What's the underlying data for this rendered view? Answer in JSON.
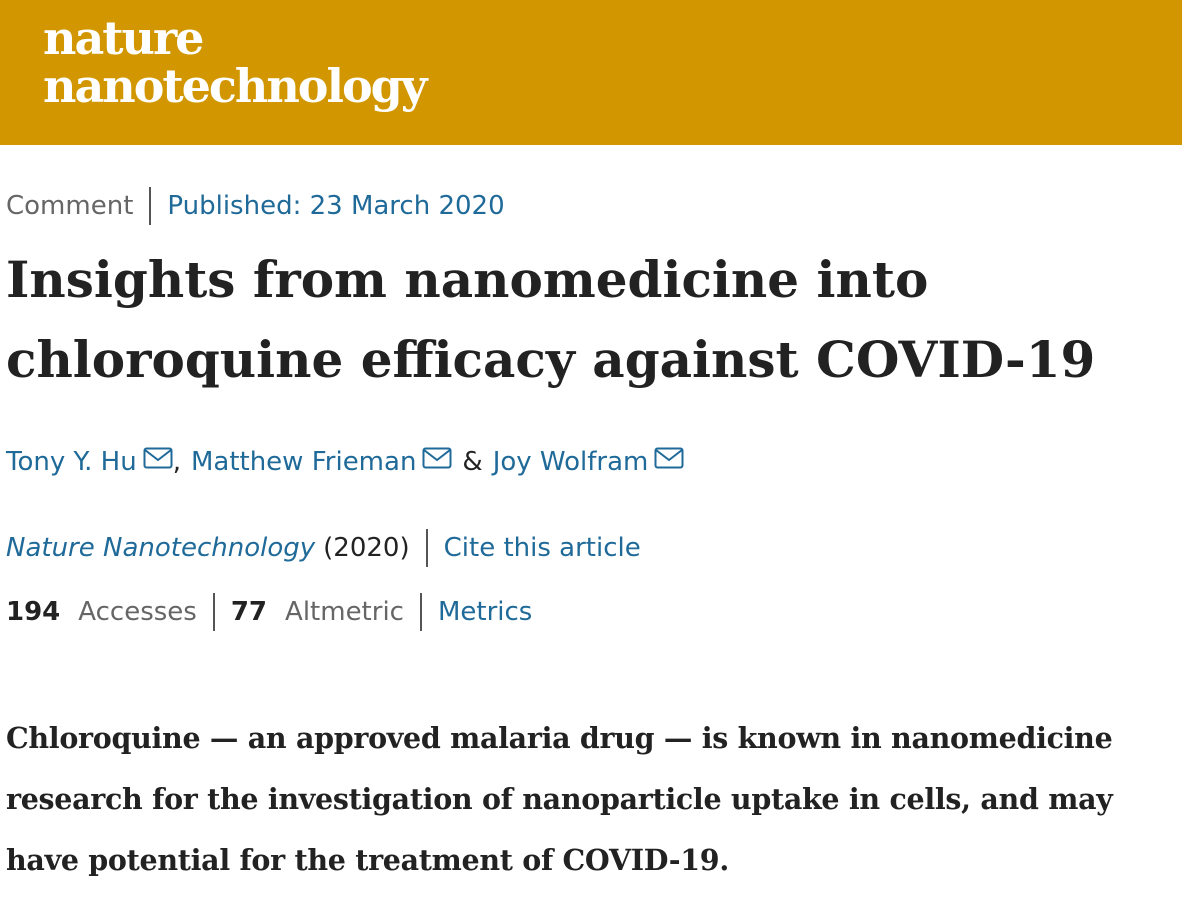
{
  "header": {
    "logo_line1": "nature",
    "logo_line2": "nanotechnology",
    "background_color": "#d29700"
  },
  "article": {
    "type": "Comment",
    "published": "Published: 23 March 2020",
    "title_line1": "Insights from nanomedicine into",
    "title_line2": "chloroquine efficacy against COVID-19",
    "authors": [
      {
        "name": "Tony Y. Hu",
        "icon": "mail-icon"
      },
      {
        "name": "Matthew Frieman",
        "icon": "mail-icon"
      },
      {
        "name": "Joy Wolfram",
        "icon": "mail-icon"
      }
    ],
    "author_separator_1": ",",
    "author_separator_2": "&",
    "journal": "Nature Nanotechnology",
    "year": "(2020)",
    "cite_label": "Cite this article",
    "accesses_count": "194",
    "accesses_label": "Accesses",
    "altmetric_count": "77",
    "altmetric_label": "Altmetric",
    "metrics_label": "Metrics",
    "abstract_line1": "Chloroquine — an approved malaria drug — is known in nanomedicine",
    "abstract_line2": "research for the investigation of nanoparticle uptake in cells, and may",
    "abstract_line3": "have potential for the treatment of COVID-19."
  },
  "colors": {
    "link": "#1f6a99",
    "text": "#222222",
    "muted": "#666666"
  }
}
